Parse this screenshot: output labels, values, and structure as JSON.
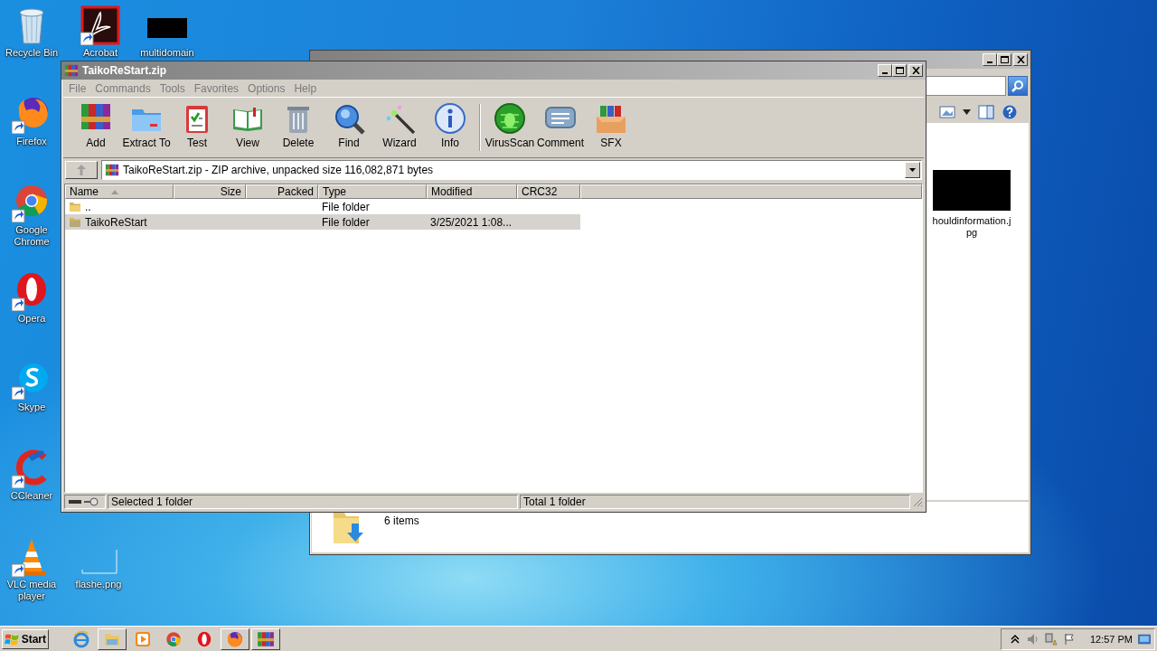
{
  "desktop": {
    "icons": [
      {
        "kind": "recycle",
        "label": "Recycle Bin",
        "shortcut": false
      },
      {
        "kind": "acrobat",
        "label": "Acrobat",
        "shortcut": true
      },
      {
        "kind": "blank",
        "label": "multidomain",
        "shortcut": false
      },
      {
        "kind": "firefox",
        "label": "Firefox",
        "shortcut": true
      },
      {
        "kind": "chrome",
        "label": "Google Chrome",
        "shortcut": true
      },
      {
        "kind": "opera",
        "label": "Opera",
        "shortcut": true
      },
      {
        "kind": "skype",
        "label": "Skype",
        "shortcut": true
      },
      {
        "kind": "ccleaner",
        "label": "CCleaner",
        "shortcut": true
      },
      {
        "kind": "vlc",
        "label": "VLC media player",
        "shortcut": true
      },
      {
        "kind": "file",
        "label": "flashe.png",
        "shortcut": false
      }
    ]
  },
  "explorer": {
    "file_label": "houldinformation.jpg",
    "details": "6 items"
  },
  "winrar": {
    "title": "TaikoReStart.zip",
    "menu": [
      "File",
      "Commands",
      "Tools",
      "Favorites",
      "Options",
      "Help"
    ],
    "toolbar_groups": [
      {
        "buttons": [
          {
            "kind": "add",
            "label": "Add"
          },
          {
            "kind": "extract",
            "label": "Extract To"
          },
          {
            "kind": "test",
            "label": "Test"
          },
          {
            "kind": "view",
            "label": "View"
          },
          {
            "kind": "delete",
            "label": "Delete"
          },
          {
            "kind": "find",
            "label": "Find"
          },
          {
            "kind": "wizard",
            "label": "Wizard"
          },
          {
            "kind": "info",
            "label": "Info"
          }
        ]
      },
      {
        "buttons": [
          {
            "kind": "virusscan",
            "label": "VirusScan"
          },
          {
            "kind": "comment",
            "label": "Comment"
          },
          {
            "kind": "sfx",
            "label": "SFX"
          }
        ]
      }
    ],
    "address": "TaikoReStart.zip - ZIP archive, unpacked size 116,082,871 bytes",
    "columns": [
      {
        "label": "Name",
        "sorted": true
      },
      {
        "label": "Size",
        "sorted": false
      },
      {
        "label": "Packed",
        "sorted": false
      },
      {
        "label": "Type",
        "sorted": false
      },
      {
        "label": "Modified",
        "sorted": false
      },
      {
        "label": "CRC32",
        "sorted": false
      }
    ],
    "rows": [
      {
        "name": "..",
        "type": "File folder",
        "modified": "",
        "selected": false
      },
      {
        "name": "TaikoReStart",
        "type": "File folder",
        "modified": "3/25/2021 1:08...",
        "selected": true
      }
    ],
    "status_left": "Selected 1 folder",
    "status_right": "Total 1 folder"
  },
  "taskbar": {
    "start": "Start",
    "apps": [
      {
        "kind": "ie",
        "active": false
      },
      {
        "kind": "explorer",
        "active": true
      },
      {
        "kind": "media",
        "active": false
      },
      {
        "kind": "chrome",
        "active": false
      },
      {
        "kind": "opera",
        "active": false
      },
      {
        "kind": "firefox",
        "active": true
      },
      {
        "kind": "winrar",
        "active": true
      }
    ],
    "clock": "12:57 PM"
  }
}
